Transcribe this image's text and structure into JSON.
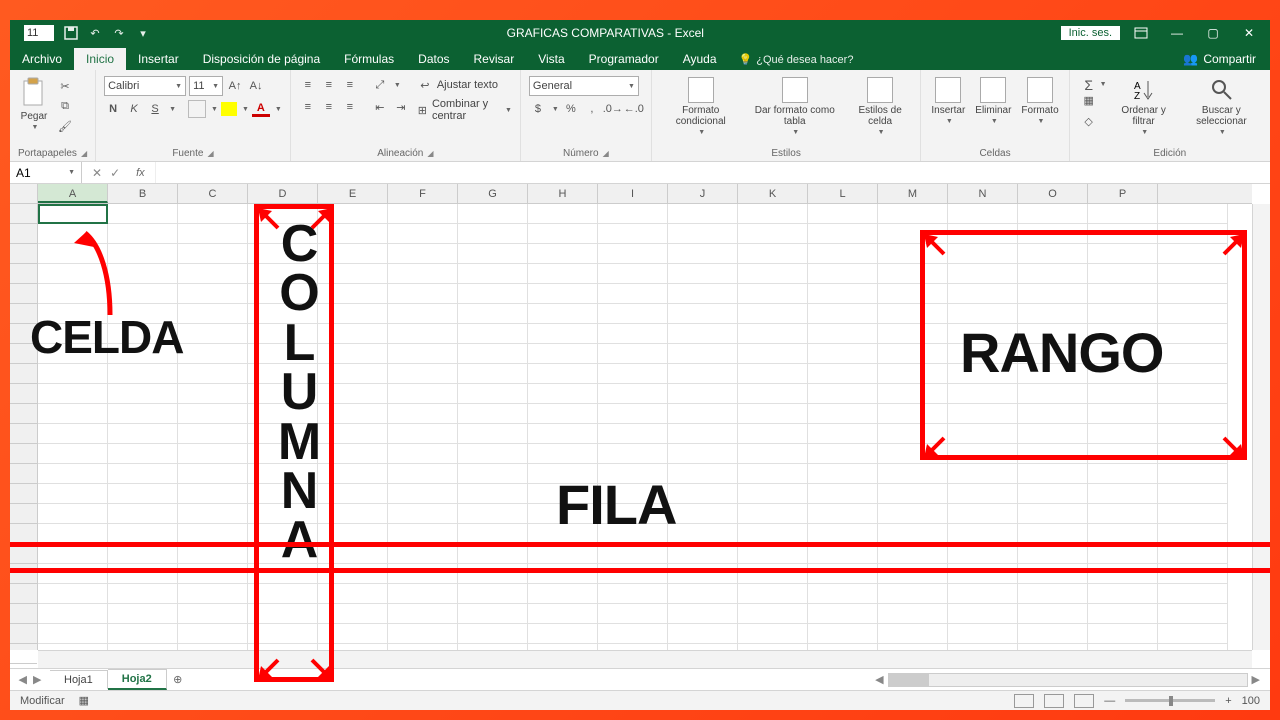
{
  "qat": {
    "value": "11",
    "title": "GRAFICAS COMPARATIVAS - Excel",
    "login": "Inic. ses."
  },
  "tabs": {
    "file": "Archivo",
    "home": "Inicio",
    "insert": "Insertar",
    "layout": "Disposición de página",
    "formulas": "Fórmulas",
    "data": "Datos",
    "review": "Revisar",
    "view": "Vista",
    "developer": "Programador",
    "help": "Ayuda",
    "tellme": "¿Qué desea hacer?"
  },
  "share": "Compartir",
  "ribbon": {
    "clipboard": {
      "paste": "Pegar",
      "label": "Portapapeles"
    },
    "font": {
      "name": "Calibri",
      "size": "11",
      "bold": "N",
      "italic": "K",
      "underline": "S",
      "label": "Fuente"
    },
    "align": {
      "wrap": "Ajustar texto",
      "merge": "Combinar y centrar",
      "label": "Alineación"
    },
    "number": {
      "format": "General",
      "label": "Número"
    },
    "styles": {
      "cond": "Formato condicional",
      "table": "Dar formato como tabla",
      "cell": "Estilos de celda",
      "label": "Estilos"
    },
    "cells": {
      "insert": "Insertar",
      "delete": "Eliminar",
      "format": "Formato",
      "label": "Celdas"
    },
    "editing": {
      "sort": "Ordenar y filtrar",
      "find": "Buscar y seleccionar",
      "label": "Edición"
    }
  },
  "namebox": "A1",
  "columns": [
    "A",
    "B",
    "C",
    "D",
    "E",
    "F",
    "G",
    "H",
    "I",
    "J",
    "K",
    "L",
    "M",
    "N",
    "O",
    "P"
  ],
  "sheets": {
    "s1": "Hoja1",
    "s2": "Hoja2"
  },
  "status": {
    "mode": "Modificar",
    "zoom": "100"
  },
  "ann": {
    "celda": "CELDA",
    "columna": "COLUMNA",
    "fila": "FILA",
    "rango": "RANGO"
  }
}
